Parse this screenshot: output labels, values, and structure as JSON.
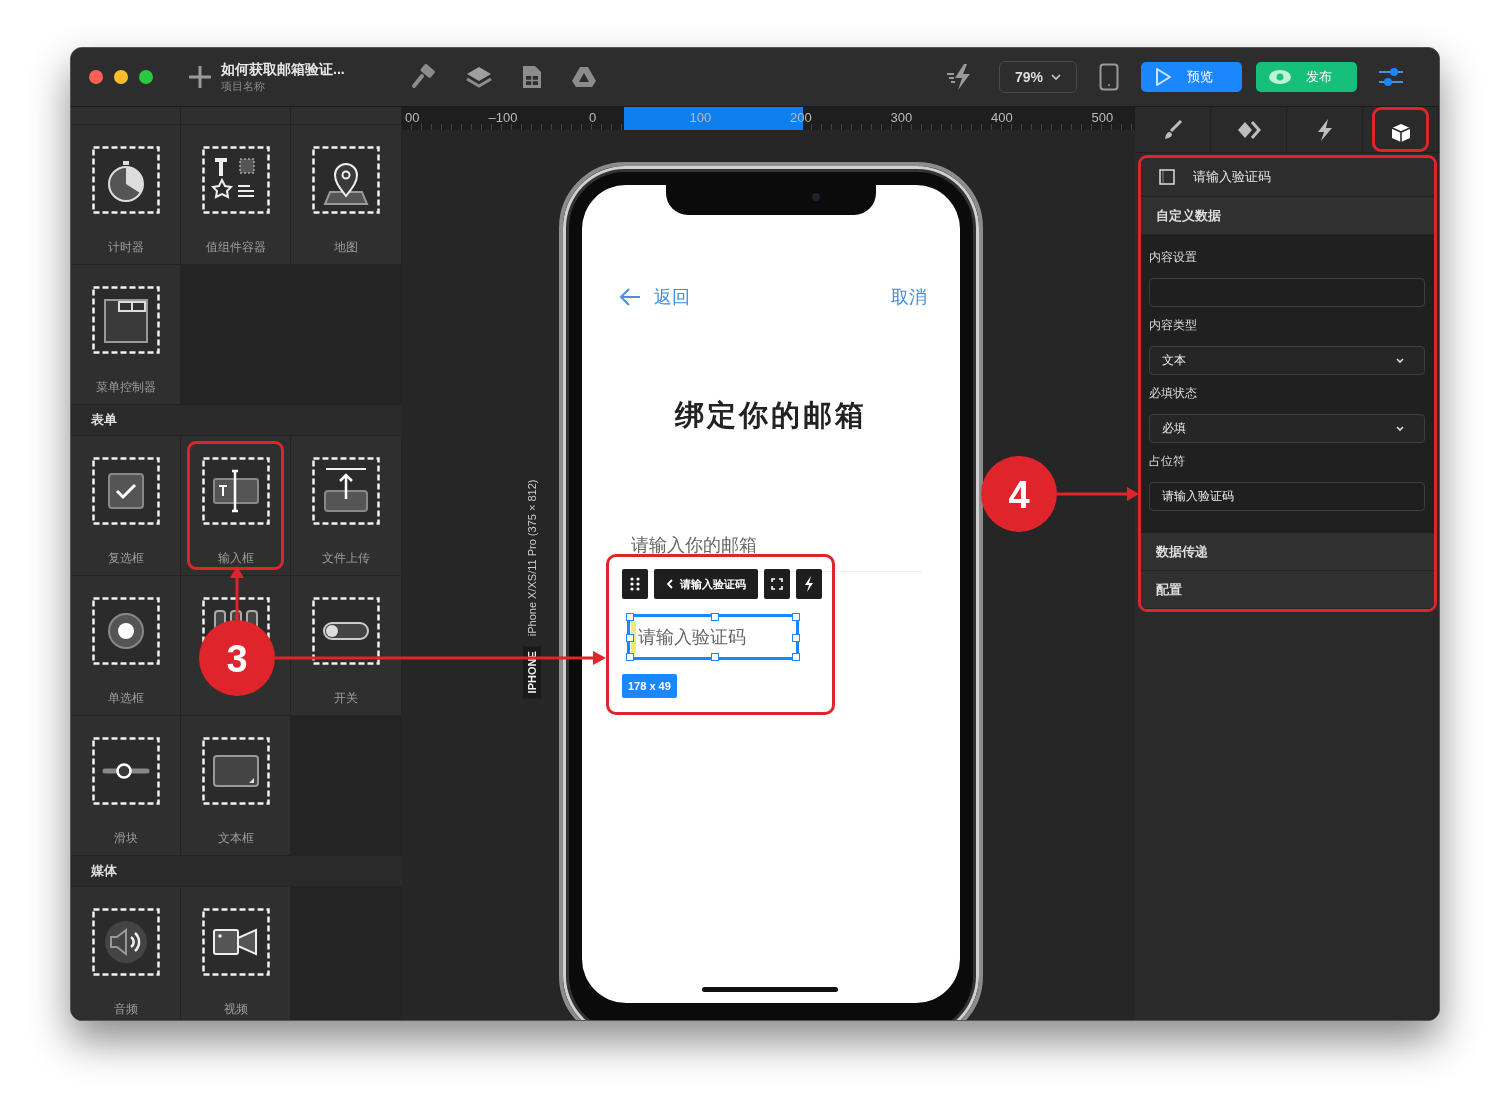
{
  "window": {
    "title": "如何获取邮箱验证...",
    "subtitle": "项目名称"
  },
  "toolbar": {
    "zoom": "79%",
    "preview": "预览",
    "publish": "发布"
  },
  "components": {
    "sections": [
      {
        "items": [
          {
            "kind": "timer",
            "label": "计时器",
            "highlighted": false
          },
          {
            "kind": "container",
            "label": "值组件容器",
            "highlighted": false
          },
          {
            "kind": "map",
            "label": "地图",
            "highlighted": false
          },
          {
            "kind": "menu",
            "label": "菜单控制器",
            "highlighted": false
          }
        ]
      },
      {
        "title": "表单",
        "items": [
          {
            "kind": "checkbox",
            "label": "复选框",
            "highlighted": false
          },
          {
            "kind": "input",
            "label": "输入框",
            "highlighted": true
          },
          {
            "kind": "upload",
            "label": "文件上传",
            "highlighted": false
          },
          {
            "kind": "radio",
            "label": "单选框",
            "highlighted": false
          },
          {
            "kind": "columns",
            "highlighted": false
          },
          {
            "kind": "switch",
            "label": "开关",
            "highlighted": false
          },
          {
            "kind": "slider",
            "label": "滑块",
            "highlighted": false
          },
          {
            "kind": "textarea",
            "label": "文本框",
            "highlighted": false
          }
        ]
      },
      {
        "title": "媒体",
        "items": [
          {
            "kind": "audio",
            "label": "音频",
            "highlighted": false
          },
          {
            "kind": "video",
            "label": "视频",
            "highlighted": false
          }
        ]
      }
    ]
  },
  "canvas": {
    "ruler": [
      "00",
      "–100",
      "0",
      "100",
      "200",
      "300",
      "400",
      "500"
    ],
    "device_badge": "IPHONE",
    "device_name": "iPhone X/XS/11 Pro (375  × 812)"
  },
  "phone": {
    "back": "返回",
    "cancel": "取消",
    "heading": "绑定你的邮箱",
    "email_placeholder": "请输入你的邮箱",
    "selection": {
      "highlighted": true,
      "label": "请输入验证码",
      "placeholder": "请输入验证码",
      "size": "178 x 49"
    }
  },
  "inspector": {
    "tabs": [
      {
        "kind": "style",
        "selected": false,
        "highlighted": false
      },
      {
        "kind": "interaction",
        "selected": false,
        "highlighted": false
      },
      {
        "kind": "event",
        "selected": false,
        "highlighted": false
      },
      {
        "kind": "component",
        "selected": true,
        "highlighted": true
      }
    ],
    "highlighted": true,
    "component_name": "请输入验证码",
    "sections": [
      {
        "title": "自定义数据",
        "fields": [
          {
            "label": "内容设置",
            "kind": "input"
          },
          {
            "label": "内容类型",
            "kind": "select",
            "value": "文本"
          },
          {
            "label": "必填状态",
            "kind": "select",
            "value": "必填"
          },
          {
            "label": "占位符",
            "kind": "input",
            "value": "请输入验证码"
          }
        ]
      },
      {
        "title": "数据传递"
      },
      {
        "title": "配置"
      }
    ]
  },
  "callouts": [
    {
      "number": "3"
    },
    {
      "number": "4"
    }
  ]
}
